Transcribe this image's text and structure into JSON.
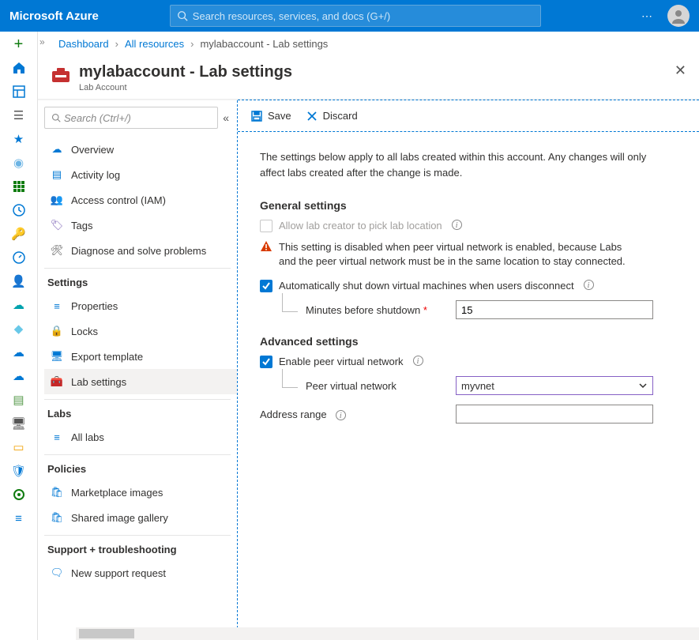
{
  "header": {
    "brand": "Microsoft Azure",
    "search_placeholder": "Search resources, services, and docs (G+/)"
  },
  "breadcrumb": {
    "dashboard": "Dashboard",
    "all_resources": "All resources",
    "current": "mylabaccount - Lab settings"
  },
  "blade": {
    "title": "mylabaccount - Lab settings",
    "subtitle": "Lab Account"
  },
  "sidebar": {
    "search_placeholder": "Search (Ctrl+/)",
    "items": {
      "overview": "Overview",
      "activity": "Activity log",
      "iam": "Access control (IAM)",
      "tags": "Tags",
      "diag": "Diagnose and solve problems"
    },
    "sections": {
      "settings": "Settings",
      "settings_items": {
        "properties": "Properties",
        "locks": "Locks",
        "export": "Export template",
        "lab_settings": "Lab settings"
      },
      "labs": "Labs",
      "labs_items": {
        "all": "All labs"
      },
      "policies": "Policies",
      "policies_items": {
        "marketplace": "Marketplace images",
        "shared": "Shared image gallery"
      },
      "support": "Support + troubleshooting",
      "support_items": {
        "new_req": "New support request"
      }
    }
  },
  "toolbar": {
    "save": "Save",
    "discard": "Discard"
  },
  "pane": {
    "description": "The settings below apply to all labs created within this account. Any changes will only affect labs created after the change is made.",
    "general_h": "General settings",
    "allow_location": "Allow lab creator to pick lab location",
    "warning": "This setting is disabled when peer virtual network is enabled, because Labs and the peer virtual network must be in the same location to stay connected.",
    "auto_shutdown": "Automatically shut down virtual machines when users disconnect",
    "minutes_lbl": "Minutes before shutdown",
    "minutes_val": "15",
    "advanced_h": "Advanced settings",
    "enable_peer": "Enable peer virtual network",
    "peer_lbl": "Peer virtual network",
    "peer_val": "myvnet",
    "addr_lbl": "Address range"
  }
}
